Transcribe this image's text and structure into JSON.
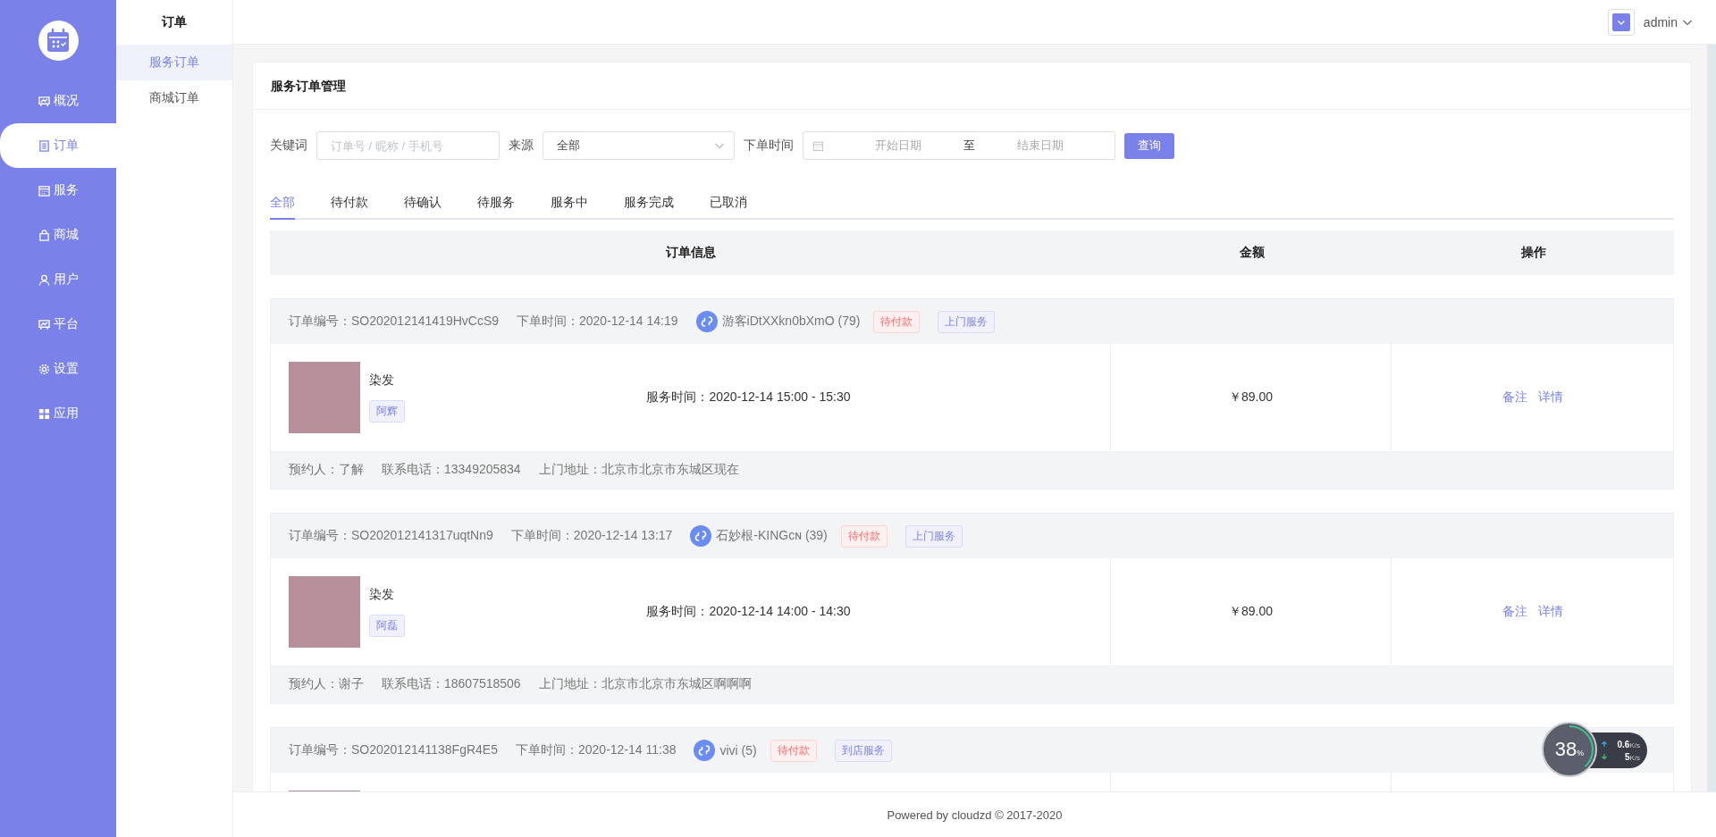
{
  "nav": {
    "items": [
      {
        "label": "概况",
        "selected": false
      },
      {
        "label": "订单",
        "selected": true
      },
      {
        "label": "服务",
        "selected": false
      },
      {
        "label": "商城",
        "selected": false
      },
      {
        "label": "用户",
        "selected": false
      },
      {
        "label": "平台",
        "selected": false
      },
      {
        "label": "设置",
        "selected": false
      },
      {
        "label": "应用",
        "selected": false
      }
    ]
  },
  "subnav": {
    "title": "订单",
    "items": [
      {
        "label": "服务订单",
        "selected": true
      },
      {
        "label": "商城订单",
        "selected": false
      }
    ]
  },
  "topbar": {
    "user": "admin"
  },
  "card": {
    "title": "服务订单管理"
  },
  "filters": {
    "keyword_label": "关键词",
    "keyword_placeholder": "订单号 / 昵称 / 手机号",
    "source_label": "来源",
    "source_value": "全部",
    "time_label": "下单时间",
    "start_placeholder": "开始日期",
    "separator": "至",
    "end_placeholder": "结束日期",
    "query_button": "查询"
  },
  "tabs": [
    {
      "label": "全部",
      "selected": true
    },
    {
      "label": "待付款",
      "selected": false
    },
    {
      "label": "待确认",
      "selected": false
    },
    {
      "label": "待服务",
      "selected": false
    },
    {
      "label": "服务中",
      "selected": false
    },
    {
      "label": "服务完成",
      "selected": false
    },
    {
      "label": "已取消",
      "selected": false
    }
  ],
  "table": {
    "columns": [
      "订单信息",
      "金额",
      "操作"
    ]
  },
  "orders": [
    {
      "order_no": "订单编号：SO202012141419HvCcS9",
      "order_time": "下单时间：2020-12-14 14:19",
      "customer": "游客iDtXXkn0bXmO (79)",
      "tags": [
        {
          "text": "待付款",
          "kind": "status"
        },
        {
          "text": "上门服务",
          "kind": "service"
        }
      ],
      "item": {
        "name": "染发",
        "staff": "阿辉",
        "service_time": "服务时间：2020-12-14 15:00 - 15:30",
        "amount": "￥89.00",
        "actions": [
          "备注",
          "详情"
        ]
      },
      "footer": [
        "预约人：了解",
        "联系电话：13349205834",
        "上门地址：北京市北京市东城区现在"
      ]
    },
    {
      "order_no": "订单编号：SO202012141317uqtNn9",
      "order_time": "下单时间：2020-12-14 13:17",
      "customer": "石妙根-KINGᴄɴ (39)",
      "tags": [
        {
          "text": "待付款",
          "kind": "status"
        },
        {
          "text": "上门服务",
          "kind": "service"
        }
      ],
      "item": {
        "name": "染发",
        "staff": "阿磊",
        "service_time": "服务时间：2020-12-14 14:00 - 14:30",
        "amount": "￥89.00",
        "actions": [
          "备注",
          "详情"
        ]
      },
      "footer": [
        "预约人：谢子",
        "联系电话：18607518506",
        "上门地址：北京市北京市东城区啊啊啊"
      ]
    },
    {
      "order_no": "订单编号：SO202012141138FgR4E5",
      "order_time": "下单时间：2020-12-14 11:38",
      "customer": "vivi (5)",
      "tags": [
        {
          "text": "待付款",
          "kind": "status"
        },
        {
          "text": "到店服务",
          "kind": "service"
        }
      ]
    }
  ],
  "footer": {
    "text": "Powered by cloudzd © 2017-2020"
  },
  "net_widget": {
    "level": 0.38,
    "percent": "38",
    "percent_unit": "%",
    "up": "0.6",
    "up_unit": "K/s",
    "down": "5",
    "down_unit": "K/s"
  }
}
